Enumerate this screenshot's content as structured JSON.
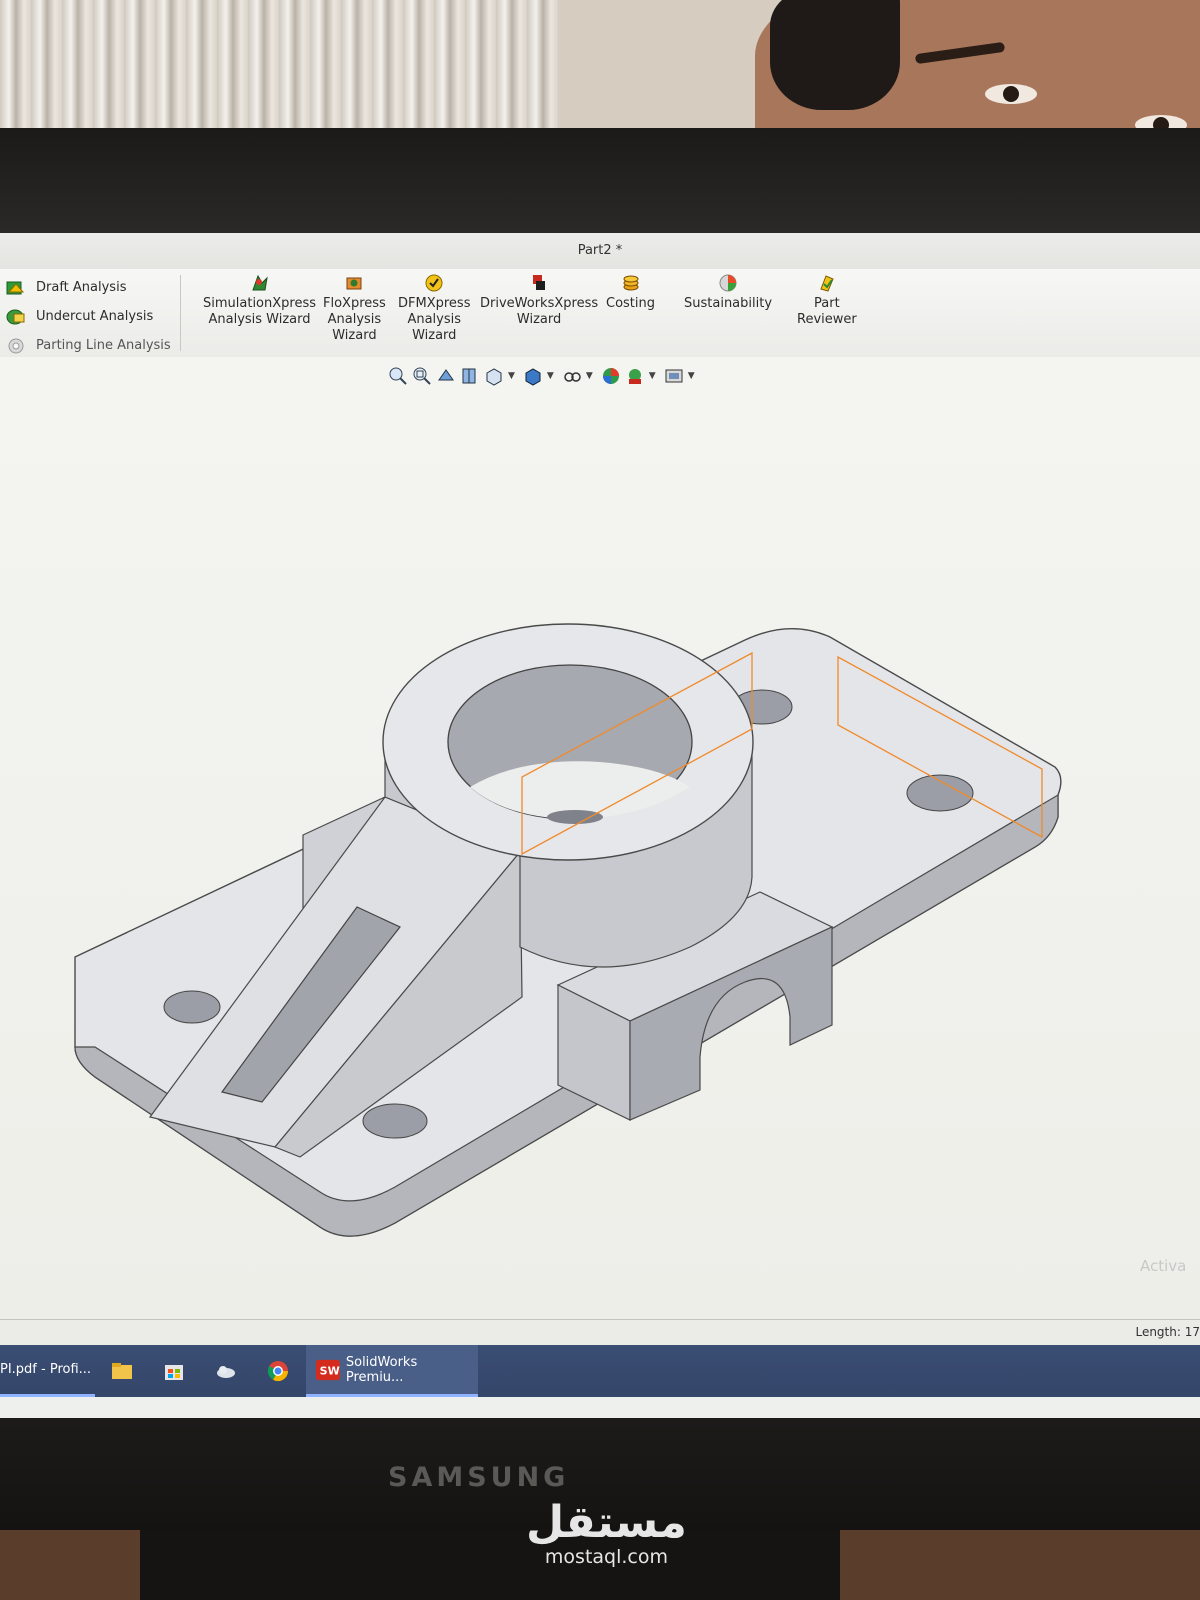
{
  "window": {
    "title": "Part2 *"
  },
  "left_tools": [
    {
      "label": "Draft Analysis",
      "icon": "draft-analysis-icon"
    },
    {
      "label": "Undercut Analysis",
      "icon": "undercut-analysis-icon"
    },
    {
      "label": "Parting Line Analysis",
      "icon": "parting-line-analysis-icon"
    }
  ],
  "tools": [
    {
      "l1": "SimulationXpress",
      "l2": "Analysis Wizard",
      "l3": "",
      "icon": "simulationxpress-icon"
    },
    {
      "l1": "FloXpress",
      "l2": "Analysis",
      "l3": "Wizard",
      "icon": "floxpress-icon"
    },
    {
      "l1": "DFMXpress",
      "l2": "Analysis",
      "l3": "Wizard",
      "icon": "dfmxpress-icon"
    },
    {
      "l1": "DriveWorksXpress",
      "l2": "Wizard",
      "l3": "",
      "icon": "driveworksxpress-icon"
    },
    {
      "l1": "Costing",
      "l2": "",
      "l3": "",
      "icon": "costing-icon"
    },
    {
      "l1": "Sustainability",
      "l2": "",
      "l3": "",
      "icon": "sustainability-icon"
    },
    {
      "l1": "Part",
      "l2": "Reviewer",
      "l3": "",
      "icon": "part-reviewer-icon"
    }
  ],
  "heads_up_toolbar": [
    "zoom-to-fit-icon",
    "zoom-to-area-icon",
    "previous-view-icon",
    "section-view-icon",
    "view-orientation-icon",
    "display-style-icon",
    "hide-show-items-icon",
    "edit-appearance-icon",
    "apply-scene-icon",
    "view-settings-icon"
  ],
  "viewport": {
    "watermark": "Activa"
  },
  "status": {
    "length": "Length: 17"
  },
  "taskbar": {
    "pdf_label": "PI.pdf - Profi...",
    "solidworks_label": "SolidWorks Premiu..."
  },
  "monitor": {
    "brand": "SAMSUNG"
  },
  "overlay_logo": {
    "arabic": "مستقل",
    "latin": "mostaql.com"
  },
  "colors": {
    "sketch_plane": "#f08a2c",
    "taskbar": "#3a4d72",
    "model_face": "#e6e7ea"
  }
}
